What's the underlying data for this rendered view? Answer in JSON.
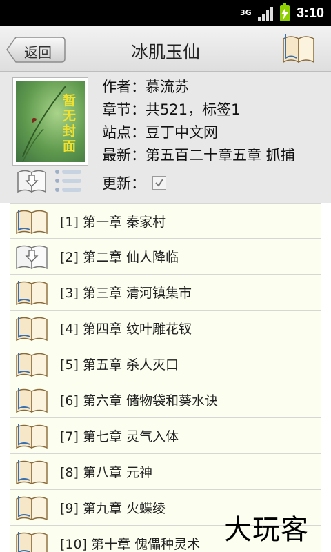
{
  "status_bar": {
    "network": "3G",
    "time": "3:10"
  },
  "header": {
    "back_label": "返回",
    "title": "冰肌玉仙"
  },
  "cover": {
    "text": "暂无封面"
  },
  "book": {
    "author_line": "作者：慕流苏",
    "chapters_line": "章节：共521，标签1",
    "site_line": "站点：豆丁中文网",
    "latest_line": "最新：第五百二十章五章 抓捕",
    "update_label": "更新：",
    "update_checked": true
  },
  "chapters": [
    {
      "label": "[1]  第一章 秦家村",
      "icon": "book-icon"
    },
    {
      "label": "[2]  第二章 仙人降临",
      "icon": "download-book-icon"
    },
    {
      "label": "[3]  第三章 清河镇集市",
      "icon": "book-icon"
    },
    {
      "label": "[4]  第四章 纹叶雕花钗",
      "icon": "book-icon"
    },
    {
      "label": "[5]  第五章 杀人灭口",
      "icon": "book-icon"
    },
    {
      "label": "[6]  第六章 储物袋和葵水诀",
      "icon": "book-icon"
    },
    {
      "label": "[7]  第七章 灵气入体",
      "icon": "book-icon"
    },
    {
      "label": "[8]  第八章 元神",
      "icon": "book-icon"
    },
    {
      "label": "[9]  第九章 火蝶绫",
      "icon": "book-icon"
    },
    {
      "label": "[10]  第十章 傀儡种灵术",
      "icon": "book-icon"
    }
  ],
  "watermark": "大玩客",
  "colors": {
    "list_bg": "#fcfff0",
    "battery": "#8fd000",
    "panel": "#e8e8e8"
  }
}
